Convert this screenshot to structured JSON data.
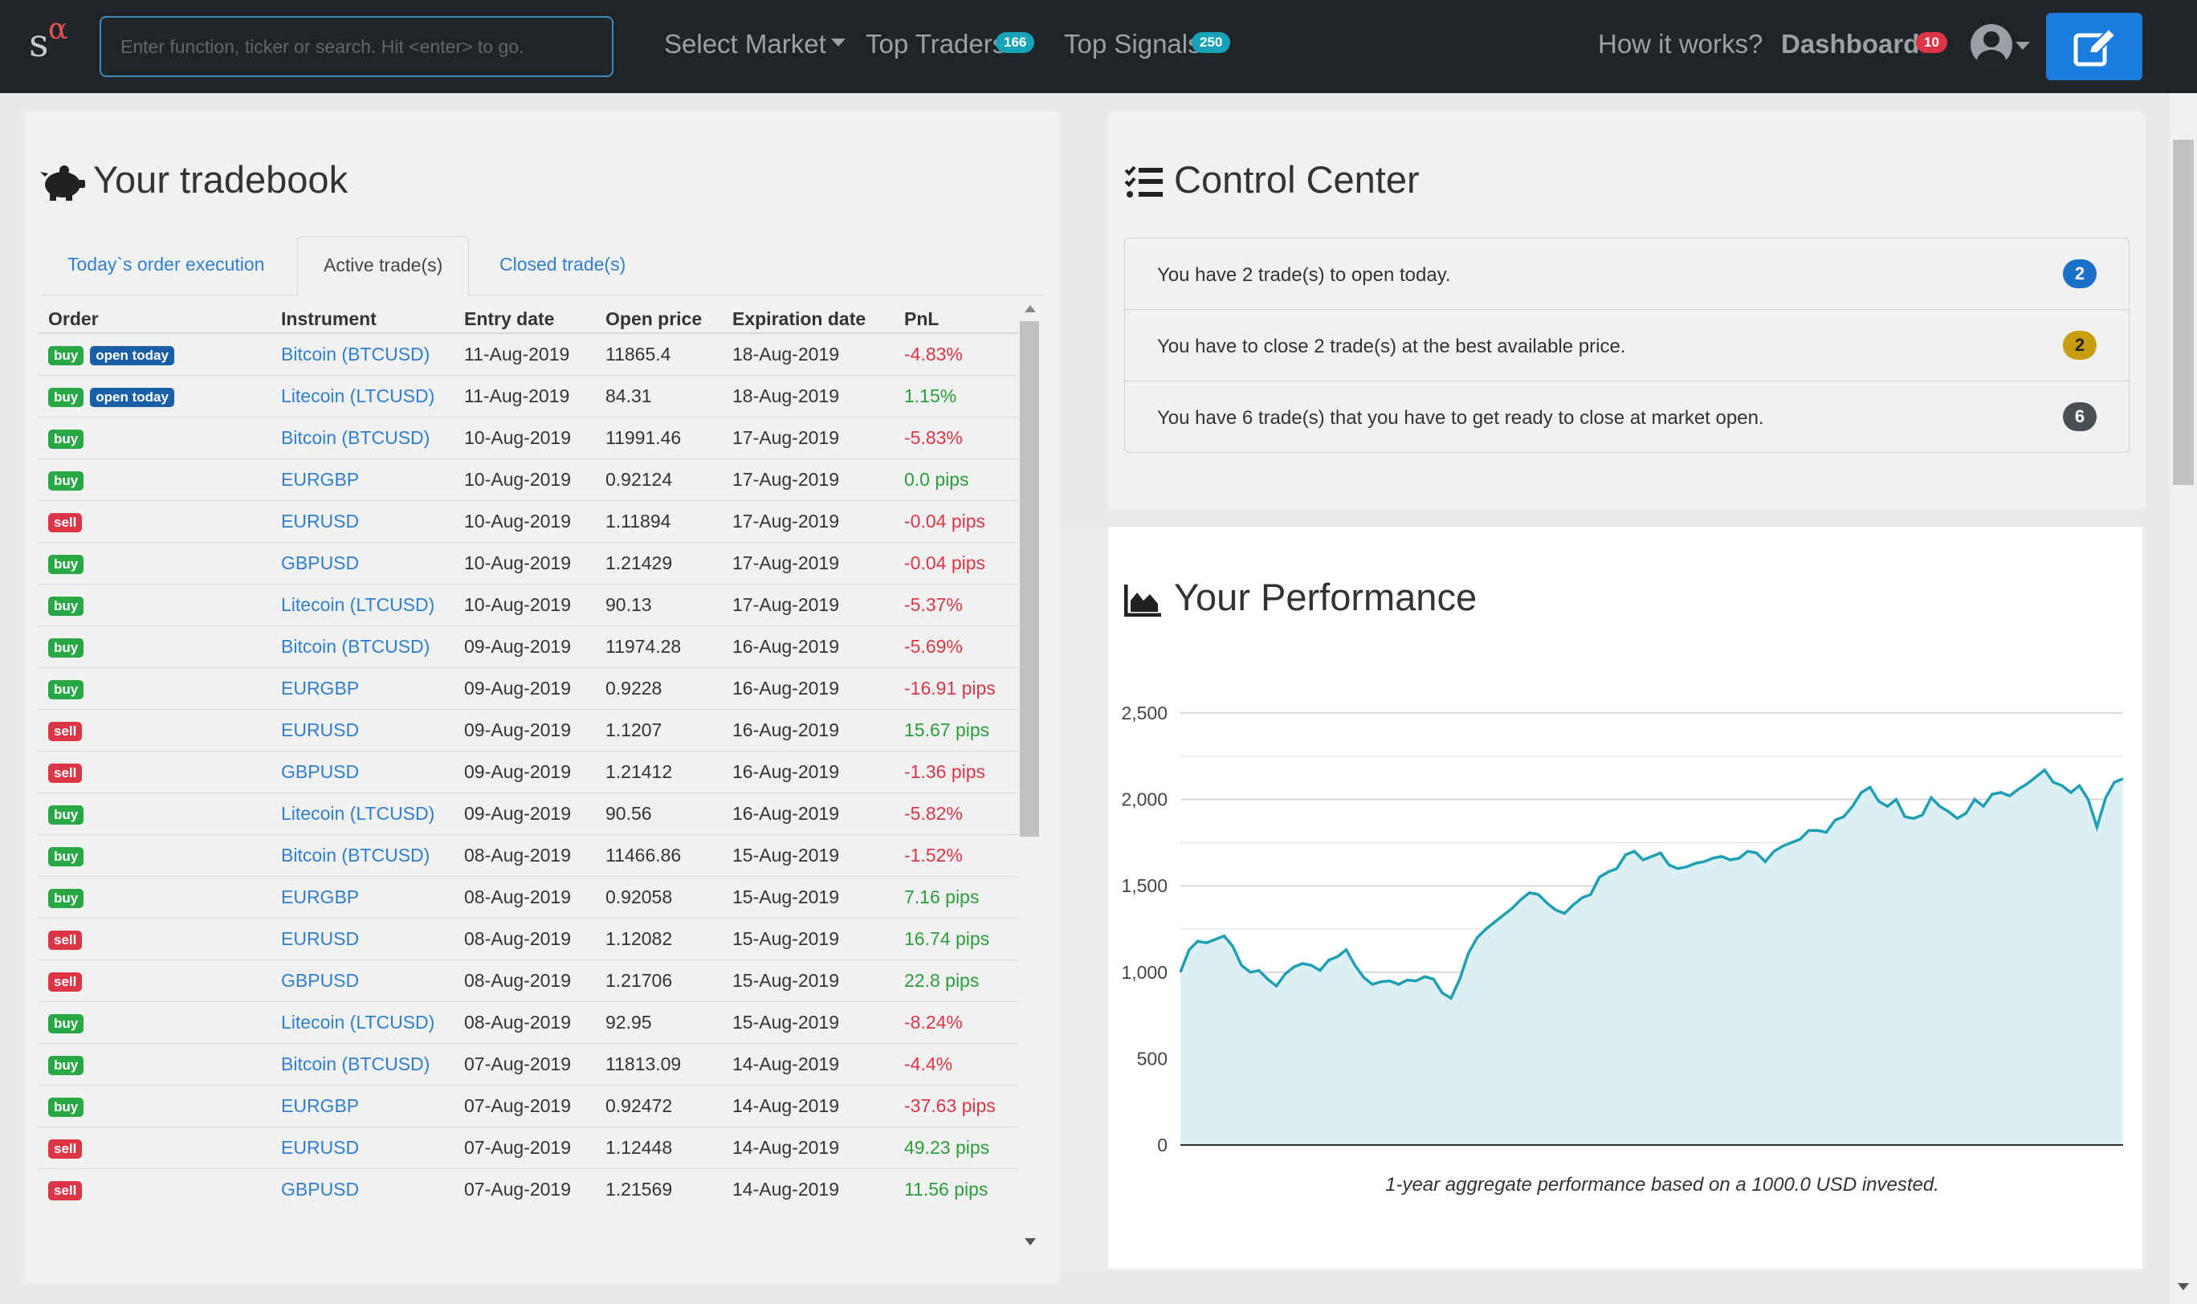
{
  "navbar": {
    "logo_s": "s",
    "logo_alpha": "α",
    "search_placeholder": "Enter function, ticker or search. Hit <enter> to go.",
    "select_market": "Select Market",
    "top_traders": "Top Traders",
    "top_traders_count": "166",
    "top_signals": "Top Signals",
    "top_signals_count": "250",
    "how_it_works": "How it works?",
    "dashboard": "Dashboard",
    "dashboard_count": "10"
  },
  "tradebook": {
    "title": "Your tradebook",
    "tabs": [
      {
        "label": "Today`s order execution",
        "active": false
      },
      {
        "label": "Active trade(s)",
        "active": true
      },
      {
        "label": "Closed trade(s)",
        "active": false
      }
    ],
    "columns": [
      "Order",
      "Instrument",
      "Entry date",
      "Open price",
      "Expiration date",
      "PnL"
    ],
    "rows": [
      {
        "order": "buy",
        "open_today": "open today",
        "instrument": "Bitcoin (BTCUSD)",
        "entry": "11-Aug-2019",
        "price": "11865.4",
        "expiry": "18-Aug-2019",
        "pnl": "-4.83%",
        "sign": "neg"
      },
      {
        "order": "buy",
        "open_today": "open today",
        "instrument": "Litecoin (LTCUSD)",
        "entry": "11-Aug-2019",
        "price": "84.31",
        "expiry": "18-Aug-2019",
        "pnl": "1.15%",
        "sign": "pos"
      },
      {
        "order": "buy",
        "open_today": "",
        "instrument": "Bitcoin (BTCUSD)",
        "entry": "10-Aug-2019",
        "price": "11991.46",
        "expiry": "17-Aug-2019",
        "pnl": "-5.83%",
        "sign": "neg"
      },
      {
        "order": "buy",
        "open_today": "",
        "instrument": "EURGBP",
        "entry": "10-Aug-2019",
        "price": "0.92124",
        "expiry": "17-Aug-2019",
        "pnl": "0.0 pips",
        "sign": "pos"
      },
      {
        "order": "sell",
        "open_today": "",
        "instrument": "EURUSD",
        "entry": "10-Aug-2019",
        "price": "1.11894",
        "expiry": "17-Aug-2019",
        "pnl": "-0.04 pips",
        "sign": "neg"
      },
      {
        "order": "buy",
        "open_today": "",
        "instrument": "GBPUSD",
        "entry": "10-Aug-2019",
        "price": "1.21429",
        "expiry": "17-Aug-2019",
        "pnl": "-0.04 pips",
        "sign": "neg"
      },
      {
        "order": "buy",
        "open_today": "",
        "instrument": "Litecoin (LTCUSD)",
        "entry": "10-Aug-2019",
        "price": "90.13",
        "expiry": "17-Aug-2019",
        "pnl": "-5.37%",
        "sign": "neg"
      },
      {
        "order": "buy",
        "open_today": "",
        "instrument": "Bitcoin (BTCUSD)",
        "entry": "09-Aug-2019",
        "price": "11974.28",
        "expiry": "16-Aug-2019",
        "pnl": "-5.69%",
        "sign": "neg"
      },
      {
        "order": "buy",
        "open_today": "",
        "instrument": "EURGBP",
        "entry": "09-Aug-2019",
        "price": "0.9228",
        "expiry": "16-Aug-2019",
        "pnl": "-16.91 pips",
        "sign": "neg"
      },
      {
        "order": "sell",
        "open_today": "",
        "instrument": "EURUSD",
        "entry": "09-Aug-2019",
        "price": "1.1207",
        "expiry": "16-Aug-2019",
        "pnl": "15.67 pips",
        "sign": "pos"
      },
      {
        "order": "sell",
        "open_today": "",
        "instrument": "GBPUSD",
        "entry": "09-Aug-2019",
        "price": "1.21412",
        "expiry": "16-Aug-2019",
        "pnl": "-1.36 pips",
        "sign": "neg"
      },
      {
        "order": "buy",
        "open_today": "",
        "instrument": "Litecoin (LTCUSD)",
        "entry": "09-Aug-2019",
        "price": "90.56",
        "expiry": "16-Aug-2019",
        "pnl": "-5.82%",
        "sign": "neg"
      },
      {
        "order": "buy",
        "open_today": "",
        "instrument": "Bitcoin (BTCUSD)",
        "entry": "08-Aug-2019",
        "price": "11466.86",
        "expiry": "15-Aug-2019",
        "pnl": "-1.52%",
        "sign": "neg"
      },
      {
        "order": "buy",
        "open_today": "",
        "instrument": "EURGBP",
        "entry": "08-Aug-2019",
        "price": "0.92058",
        "expiry": "15-Aug-2019",
        "pnl": "7.16 pips",
        "sign": "pos"
      },
      {
        "order": "sell",
        "open_today": "",
        "instrument": "EURUSD",
        "entry": "08-Aug-2019",
        "price": "1.12082",
        "expiry": "15-Aug-2019",
        "pnl": "16.74 pips",
        "sign": "pos"
      },
      {
        "order": "sell",
        "open_today": "",
        "instrument": "GBPUSD",
        "entry": "08-Aug-2019",
        "price": "1.21706",
        "expiry": "15-Aug-2019",
        "pnl": "22.8 pips",
        "sign": "pos"
      },
      {
        "order": "buy",
        "open_today": "",
        "instrument": "Litecoin (LTCUSD)",
        "entry": "08-Aug-2019",
        "price": "92.95",
        "expiry": "15-Aug-2019",
        "pnl": "-8.24%",
        "sign": "neg"
      },
      {
        "order": "buy",
        "open_today": "",
        "instrument": "Bitcoin (BTCUSD)",
        "entry": "07-Aug-2019",
        "price": "11813.09",
        "expiry": "14-Aug-2019",
        "pnl": "-4.4%",
        "sign": "neg"
      },
      {
        "order": "buy",
        "open_today": "",
        "instrument": "EURGBP",
        "entry": "07-Aug-2019",
        "price": "0.92472",
        "expiry": "14-Aug-2019",
        "pnl": "-37.63 pips",
        "sign": "neg"
      },
      {
        "order": "sell",
        "open_today": "",
        "instrument": "EURUSD",
        "entry": "07-Aug-2019",
        "price": "1.12448",
        "expiry": "14-Aug-2019",
        "pnl": "49.23 pips",
        "sign": "pos"
      },
      {
        "order": "sell",
        "open_today": "",
        "instrument": "GBPUSD",
        "entry": "07-Aug-2019",
        "price": "1.21569",
        "expiry": "14-Aug-2019",
        "pnl": "11.56 pips",
        "sign": "pos"
      }
    ]
  },
  "control_center": {
    "title": "Control Center",
    "items": [
      {
        "text": "You have 2 trade(s) to open today.",
        "count": "2",
        "color": "#1b6fc8"
      },
      {
        "text": "You have to close 2 trade(s) at the best available price.",
        "count": "2",
        "color": "#c89d10"
      },
      {
        "text": "You have 6 trade(s) that you have to get ready to close at market open.",
        "count": "6",
        "color": "#4a4f55"
      }
    ]
  },
  "performance": {
    "title": "Your Performance",
    "caption": "1-year aggregate performance based on a 1000.0 USD invested.",
    "chart_data": {
      "type": "area",
      "title": "",
      "xlabel": "",
      "ylabel": "",
      "ylim": [
        0,
        2500
      ],
      "yticks": [
        "0",
        "500",
        "1,000",
        "1,500",
        "2,000",
        "2,500"
      ],
      "grid": true,
      "line_color": "#1f9fb4",
      "fill_color": "#dcf0f4",
      "series": [
        {
          "values": [
            1000,
            1130,
            1180,
            1170,
            1190,
            1210,
            1150,
            1040,
            1000,
            1010,
            960,
            920,
            990,
            1030,
            1050,
            1040,
            1010,
            1070,
            1090,
            1130,
            1040,
            970,
            930,
            945,
            950,
            930,
            955,
            950,
            975,
            960,
            880,
            850,
            960,
            1110,
            1200,
            1250,
            1290,
            1330,
            1370,
            1420,
            1460,
            1450,
            1400,
            1360,
            1340,
            1390,
            1430,
            1450,
            1550,
            1580,
            1600,
            1680,
            1700,
            1650,
            1670,
            1690,
            1620,
            1600,
            1610,
            1630,
            1640,
            1660,
            1670,
            1650,
            1660,
            1700,
            1690,
            1640,
            1700,
            1730,
            1750,
            1770,
            1820,
            1820,
            1810,
            1880,
            1900,
            1960,
            2040,
            2070,
            1990,
            1960,
            2000,
            1900,
            1890,
            1910,
            2010,
            1960,
            1930,
            1890,
            1920,
            2000,
            1960,
            2030,
            2040,
            2020,
            2060,
            2090,
            2130,
            2170,
            2100,
            2080,
            2040,
            2080,
            2000,
            1840,
            2010,
            2100,
            2120
          ]
        }
      ]
    }
  }
}
